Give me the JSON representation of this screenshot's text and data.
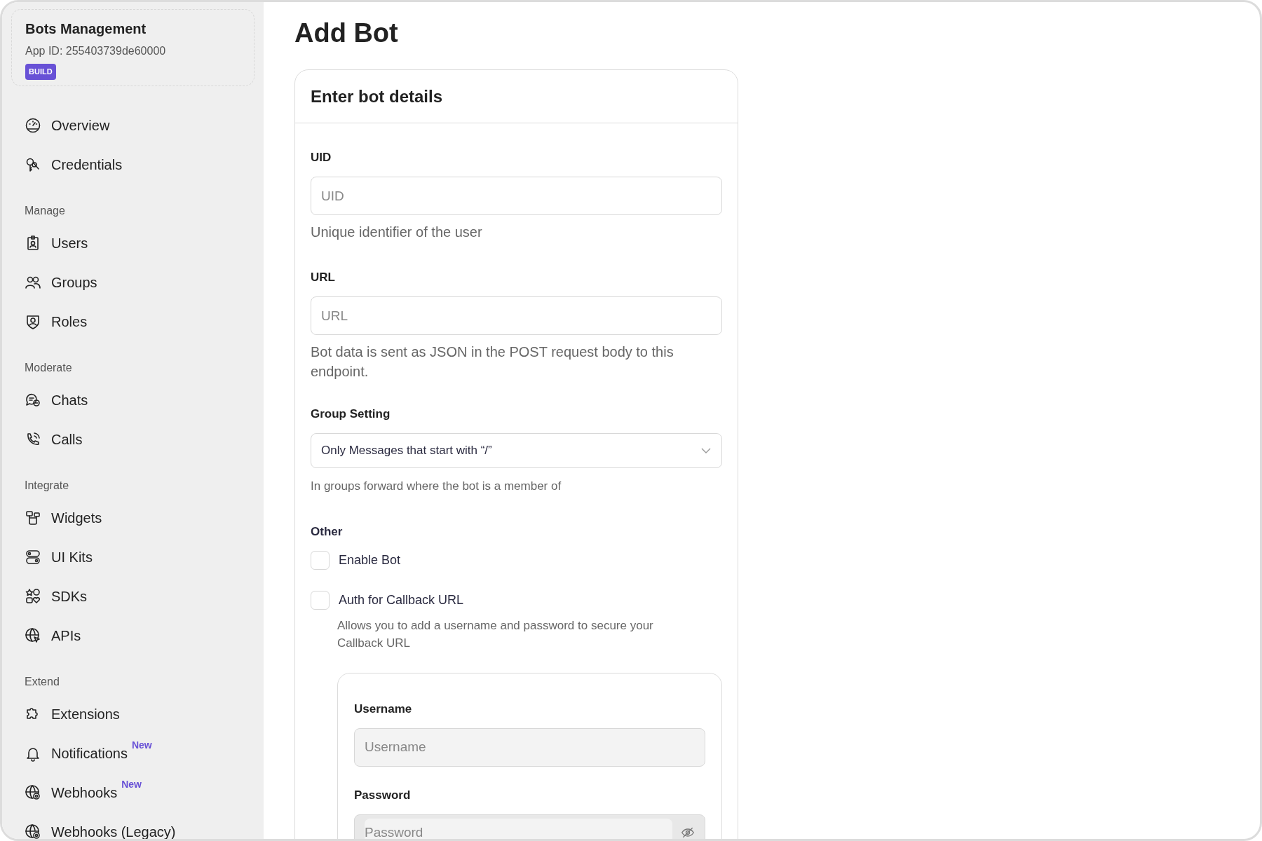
{
  "app": {
    "name": "Bots Management",
    "app_id": "App ID: 255403739de60000",
    "badge": "BUILD"
  },
  "sidebar": {
    "sections": [
      {
        "items": [
          {
            "label": "Overview"
          },
          {
            "label": "Credentials"
          }
        ]
      },
      {
        "heading": "Manage",
        "items": [
          {
            "label": "Users"
          },
          {
            "label": "Groups"
          },
          {
            "label": "Roles"
          }
        ]
      },
      {
        "heading": "Moderate",
        "items": [
          {
            "label": "Chats"
          },
          {
            "label": "Calls"
          }
        ]
      },
      {
        "heading": "Integrate",
        "items": [
          {
            "label": "Widgets"
          },
          {
            "label": "UI Kits"
          },
          {
            "label": "SDKs"
          },
          {
            "label": "APIs"
          }
        ]
      },
      {
        "heading": "Extend",
        "items": [
          {
            "label": "Extensions"
          },
          {
            "label": "Notifications",
            "badge": "New"
          },
          {
            "label": "Webhooks",
            "badge": "New"
          },
          {
            "label": "Webhooks (Legacy)"
          }
        ]
      }
    ]
  },
  "page_title": "Add Bot",
  "form": {
    "title": "Enter bot details",
    "fields": [
      {
        "kind": "input",
        "label": "UID",
        "placeholder": "UID",
        "help": "Unique identifier of the user"
      },
      {
        "kind": "input",
        "label": "URL",
        "placeholder": "URL",
        "help": "Bot data is sent as JSON in the POST request body to this endpoint."
      },
      {
        "kind": "select",
        "label": "Group Setting",
        "value": "Only Messages that start with “/”",
        "help": "In groups forward where the bot is a member of"
      }
    ],
    "other": {
      "label": "Other",
      "options": [
        {
          "label": "Enable Bot",
          "checked": false
        },
        {
          "label": "Auth for Callback URL",
          "checked": false,
          "help": "Allows you to add a username and password to secure your Callback URL"
        }
      ]
    },
    "auth_fields": [
      {
        "kind": "input",
        "label": "Username",
        "placeholder": "Username",
        "disabled": true
      },
      {
        "kind": "password",
        "label": "Password",
        "placeholder": "Password",
        "disabled": true
      }
    ]
  }
}
